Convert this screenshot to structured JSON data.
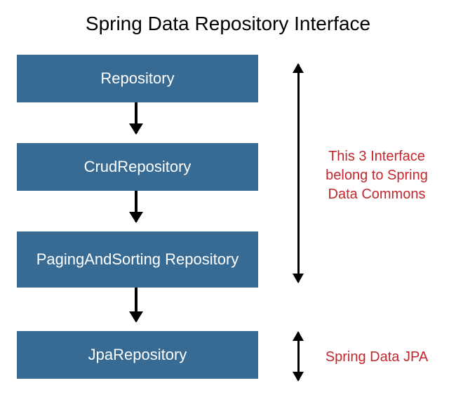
{
  "title": "Spring Data Repository Interface",
  "boxes": {
    "b1": "Repository",
    "b2": "CrudRepository",
    "b3": "PagingAndSorting Repository",
    "b4": "JpaRepository"
  },
  "notes": {
    "n1": "This 3 Interface belong to Spring Data Commons",
    "n2": "Spring Data JPA"
  },
  "colors": {
    "box": "#376b94",
    "note": "#c1272d"
  }
}
